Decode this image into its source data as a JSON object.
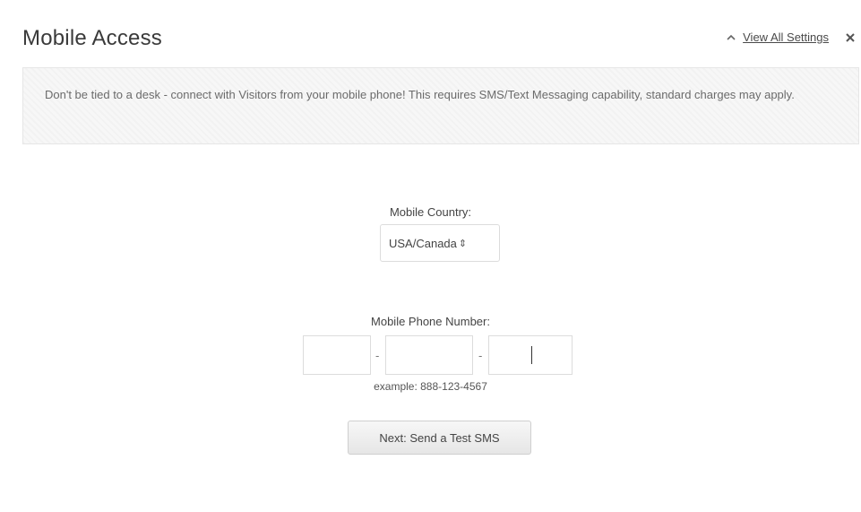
{
  "header": {
    "title": "Mobile Access",
    "view_all_link": "View All Settings",
    "caret_icon": "caret-up-icon",
    "close_icon": "close-icon"
  },
  "info": {
    "text": "Don't be tied to a desk - connect with Visitors from your mobile phone! This requires SMS/Text Messaging capability, standard charges may apply."
  },
  "country": {
    "label": "Mobile Country:",
    "selected": "USA/Canada",
    "arrows": "⇕"
  },
  "phone": {
    "label": "Mobile Phone Number:",
    "dash": "-",
    "area_value": "",
    "prefix_value": "",
    "line_value": "",
    "example": "example: 888-123-4567"
  },
  "actions": {
    "next_label": "Next: Send a Test SMS"
  },
  "colors": {
    "text": "#333333",
    "info_bg": "#f7f7f7",
    "border": "#dcdcdc"
  }
}
